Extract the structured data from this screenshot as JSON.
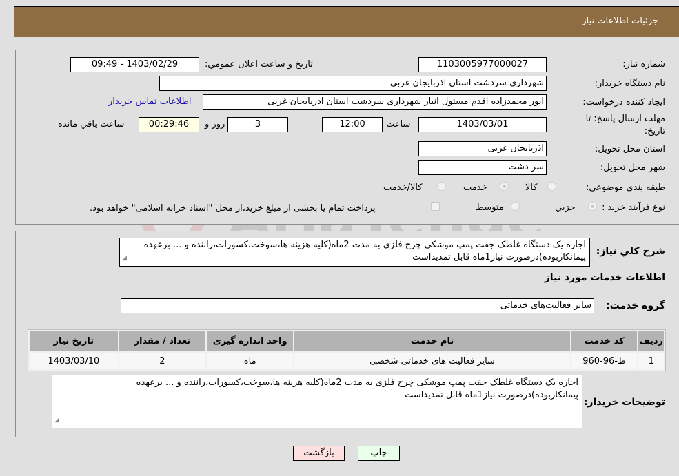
{
  "header": {
    "title": "جزئیات اطلاعات نیاز"
  },
  "form": {
    "need_number": {
      "label": "شماره نیاز:",
      "value": "1103005977000027"
    },
    "announce_datetime": {
      "label": "تاریخ و ساعت اعلان عمومي:",
      "value": "1403/02/29 - 09:49"
    },
    "buyer_org": {
      "label": "نام دستگاه خريدار:",
      "value": "شهرداری سردشت استان اذربایجان غربی"
    },
    "requester": {
      "label": "ايجاد کننده درخواست:",
      "value": "انور محمدزاده اقدم مسئول انبار شهرداری سردشت استان اذربایجان غربی"
    },
    "contact_link": "اطلاعات تماس خريدار",
    "deadline": {
      "label_line1": "مهلت ارسال پاسخ: تا",
      "label_line2": "تاریخ:",
      "date": "1403/03/01",
      "time_label": "ساعت",
      "time": "12:00",
      "days": "3",
      "days_label": "روز و",
      "remaining": "00:29:46",
      "remaining_label": "ساعت باقي مانده"
    },
    "delivery_province": {
      "label": "استان محل تحویل:",
      "value": "آذربایجان غربی"
    },
    "delivery_city": {
      "label": "شهر محل تحویل:",
      "value": "سر دشت"
    },
    "category": {
      "label": "طبقه بندی موضوعی:",
      "options": [
        "کالا",
        "خدمت",
        "کالا/خدمت"
      ],
      "selected": "خدمت"
    },
    "purchase_process": {
      "label": "نوع فرآیند خرید :",
      "options": [
        "جزيي",
        "متوسط"
      ],
      "selected": "جزيي",
      "treasury_note": "پرداخت تمام يا بخشی از مبلغ خريد،از محل \"اسناد خزانه اسلامی\" خواهد بود."
    }
  },
  "description": {
    "label": "شرح کلي نياز:",
    "value": "اجاره یک دستگاه غلطک جفت پمپ موشکی چرخ فلزی به مدت 2ماه(کلیه هزینه ها،سوخت،کسورات،راننده و ... برعهده پیمانکاربوده)درصورت نیاز1ماه قابل تمدیداست"
  },
  "services": {
    "section_title": "اطلاعات خدمات مورد نياز",
    "group_label": "گروه خدمت:",
    "group_value": "سایر فعالیت‌های خدماتی",
    "table": {
      "headers": [
        "رديف",
        "کد خدمت",
        "نام خدمت",
        "واحد اندازه گيری",
        "تعداد / مقدار",
        "تاريخ نياز"
      ],
      "rows": [
        [
          "1",
          "ط-96-960",
          "سایر فعالیت های خدماتی شخصی",
          "ماه",
          "2",
          "1403/03/10"
        ]
      ]
    }
  },
  "buyer_notes": {
    "label": "توضيحات خريدار:",
    "value": "اجاره یک دستگاه غلطک جفت پمپ موشکی چرخ فلزی به مدت 2ماه(کلیه هزینه ها،سوخت،کسورات،راننده و ... برعهده پیمانکاربوده)درصورت نیاز1ماه قابل تمدیداست"
  },
  "buttons": {
    "print": "چاپ",
    "back": "بازگشت"
  },
  "watermark": {
    "text": "AriaTender.neT"
  },
  "colors": {
    "header_bg": "#8e6d42",
    "print_bg": "#eaffea",
    "back_bg": "#ffe0e0",
    "link": "#1a0dab"
  }
}
